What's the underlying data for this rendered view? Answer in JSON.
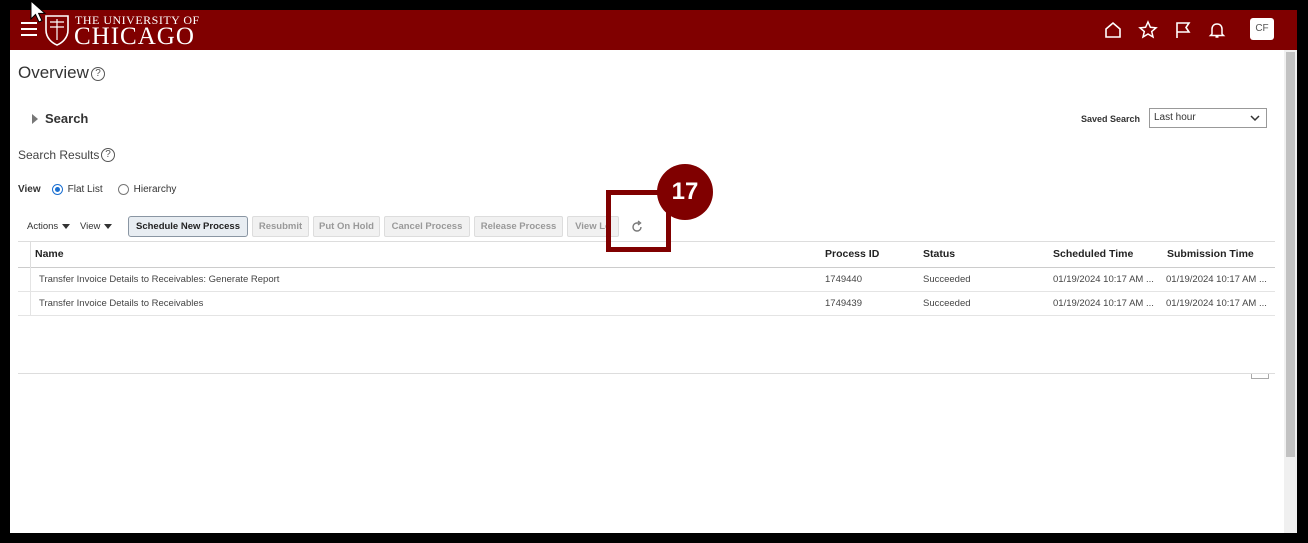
{
  "brand": {
    "line1": "THE UNIVERSITY OF",
    "line2": "CHICAGO"
  },
  "user": {
    "initials": "CF"
  },
  "page": {
    "title": "Overview",
    "help": "?"
  },
  "search": {
    "label": "Search",
    "saved_label": "Saved Search",
    "saved_value": "Last hour"
  },
  "results": {
    "label": "Search Results",
    "help": "?"
  },
  "view": {
    "label": "View",
    "options": [
      "Flat List",
      "Hierarchy"
    ],
    "selected": "Flat List"
  },
  "toolbar": {
    "actions": "Actions",
    "view": "View",
    "buttons": [
      "Schedule New Process",
      "Resubmit",
      "Put On Hold",
      "Cancel Process",
      "Release Process",
      "View Lo"
    ]
  },
  "table": {
    "columns": [
      "Name",
      "Process ID",
      "Status",
      "Scheduled Time",
      "Submission Time"
    ],
    "rows": [
      [
        "Transfer Invoice Details to Receivables: Generate Report",
        "1749440",
        "Succeeded",
        "01/19/2024 10:17 AM ...",
        "01/19/2024 10:17 AM ..."
      ],
      [
        "Transfer Invoice Details to Receivables",
        "1749439",
        "Succeeded",
        "01/19/2024 10:17 AM ...",
        "01/19/2024 10:17 AM ..."
      ]
    ]
  },
  "callout": {
    "step": "17"
  },
  "colors": {
    "brand": "#800000",
    "accent": "#1a6fd1"
  },
  "icons": [
    "menu-icon",
    "home-icon",
    "star-icon",
    "flag-icon",
    "bell-icon",
    "refresh-icon",
    "help-icon"
  ]
}
